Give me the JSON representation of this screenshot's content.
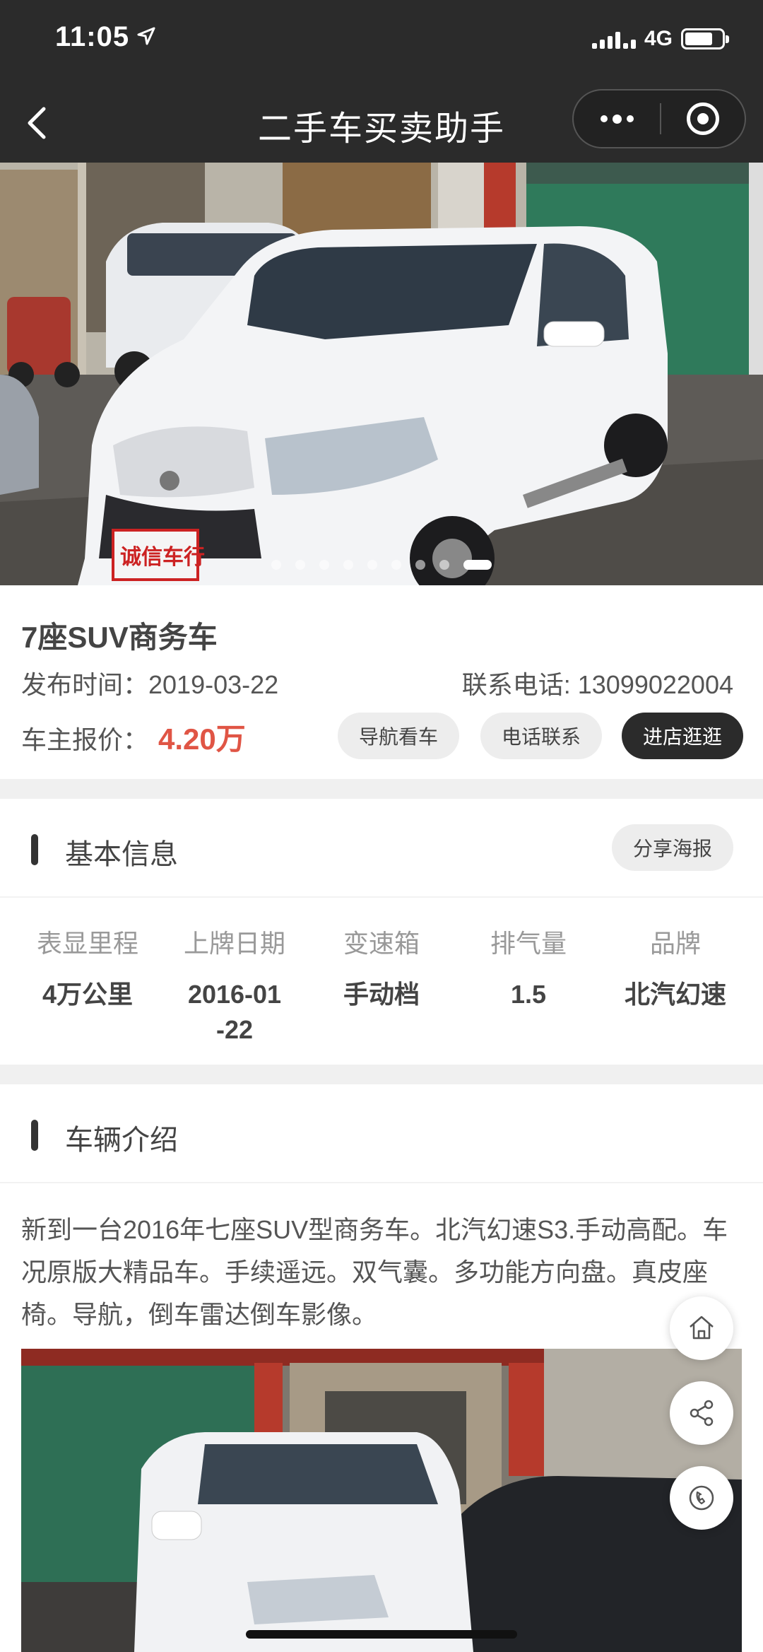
{
  "status": {
    "time": "11:05",
    "network": "4G"
  },
  "nav": {
    "title": "二手车买卖助手"
  },
  "hero": {
    "slide_count": 9,
    "active_slide": 9,
    "sign_text": "诚信车行"
  },
  "listing": {
    "title": "7座SUV商务车",
    "publish_label": "发布时间：",
    "publish_date": "2019-03-22",
    "phone_label": "联系电话: ",
    "phone": "13099022004",
    "price_label": "车主报价：",
    "price": "4.20万"
  },
  "actions": {
    "navigate": "导航看车",
    "call": "电话联系",
    "shop": "进店逛逛"
  },
  "basic_info": {
    "heading": "基本信息",
    "share_label": "分享海报",
    "items": [
      {
        "key": "表显里程",
        "value": "4万公里"
      },
      {
        "key": "上牌日期",
        "value": "2016-01-22"
      },
      {
        "key": "变速箱",
        "value": "手动档"
      },
      {
        "key": "排气量",
        "value": "1.5"
      },
      {
        "key": "品牌",
        "value": "北汽幻速"
      }
    ]
  },
  "intro": {
    "heading": "车辆介绍",
    "text": "新到一台2016年七座SUV型商务车。北汽幻速S3.手动高配。车况原版大精品车。手续遥远。双气囊。多功能方向盘。真皮座椅。导航，倒车雷达倒车影像。"
  },
  "fabs": [
    "home-icon",
    "share-icon",
    "phone-icon"
  ],
  "colors": {
    "header": "#2b2b2b",
    "price": "#e05545",
    "accent_button": "#2b2b2b"
  }
}
